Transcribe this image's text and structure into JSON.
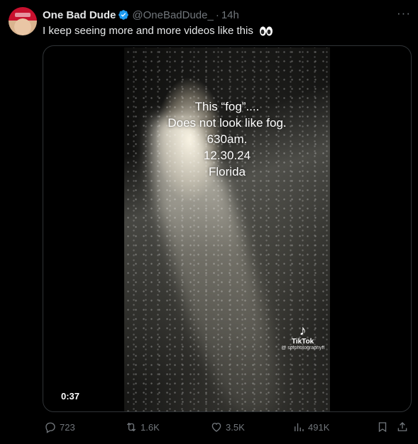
{
  "author": {
    "display_name": "One Bad Dude",
    "handle": "@OneBadDude_",
    "separator": "·",
    "time": "14h",
    "verified_color": "#1d9bf0"
  },
  "tweet": {
    "text": "I keep seeing more and more videos like this",
    "emoji": "eyes"
  },
  "video": {
    "overlay_lines": [
      "This “fog”....",
      "Does not look like fog.",
      "630am.",
      "12.30.24",
      "Florida"
    ],
    "watermark_brand": "TikTok",
    "watermark_handle": "@ spfphotographyfl",
    "duration": "0:37"
  },
  "actions": {
    "replies": "723",
    "reposts": "1.6K",
    "likes": "3.5K",
    "views": "491K"
  },
  "icons": {
    "more": "more-horizontal-icon",
    "reply": "reply-icon",
    "repost": "repost-icon",
    "like": "heart-icon",
    "views": "views-chart-icon",
    "bookmark": "bookmark-icon",
    "share": "share-icon"
  }
}
